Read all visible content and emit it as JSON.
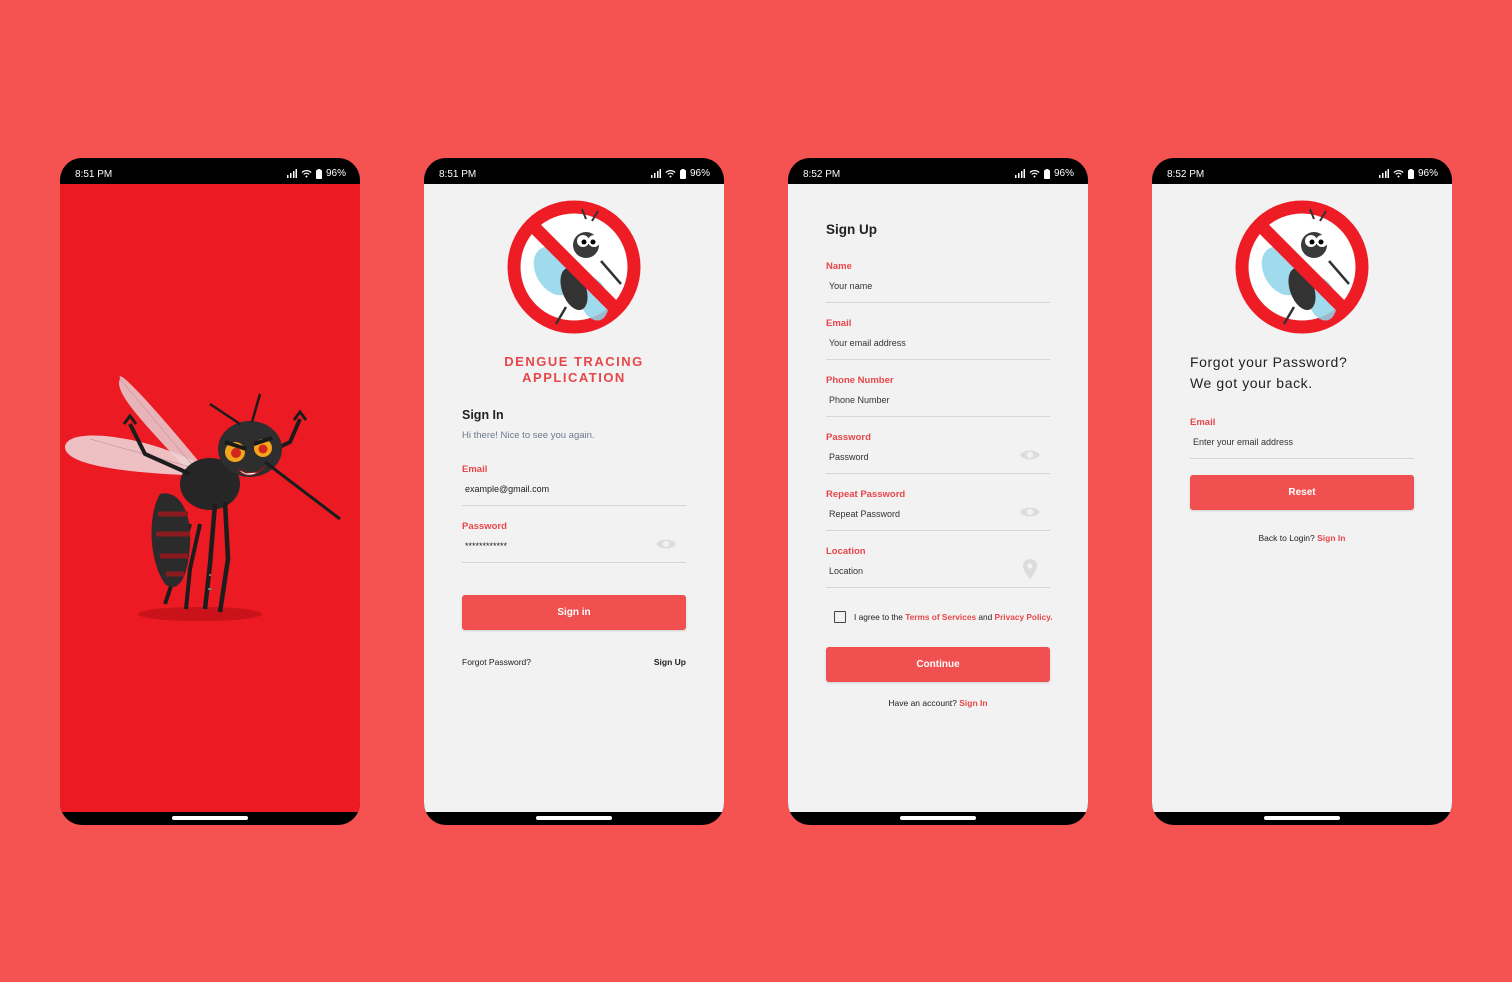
{
  "colors": {
    "background": "#f55252",
    "accent": "#f05050",
    "splash_red": "#ec1a22",
    "screen_bg": "#f2f2f2"
  },
  "phones": [
    {
      "time": "8:51 PM",
      "battery": "96%"
    },
    {
      "time": "8:51 PM",
      "battery": "96%"
    },
    {
      "time": "8:52 PM",
      "battery": "96%"
    },
    {
      "time": "8:52 PM",
      "battery": "96%"
    }
  ],
  "signin": {
    "app_title_line1": "DENGUE TRACING",
    "app_title_line2": "APPLICATION",
    "heading": "Sign In",
    "subtitle": "Hi there! Nice to see you again.",
    "email_label": "Email",
    "email_value": "example@gmail.com",
    "password_label": "Password",
    "password_value": "************",
    "button": "Sign in",
    "forgot": "Forgot Password?",
    "signup_link": "Sign Up"
  },
  "signup": {
    "heading": "Sign Up",
    "fields": [
      {
        "label": "Name",
        "placeholder": "Your name"
      },
      {
        "label": "Email",
        "placeholder": "Your email address"
      },
      {
        "label": "Phone Number",
        "placeholder": "Phone Number"
      },
      {
        "label": "Password",
        "placeholder": "Password"
      },
      {
        "label": "Repeat Password",
        "placeholder": "Repeat Password"
      },
      {
        "label": "Location",
        "placeholder": "Location"
      }
    ],
    "agree_prefix": "I agree to the ",
    "terms": "Terms of Services",
    "agree_and": " and ",
    "privacy": "Privacy Policy.",
    "button": "Continue",
    "have_account": "Have an account? ",
    "signin_link": "Sign In"
  },
  "forgot": {
    "heading_line1": "Forgot your Password?",
    "heading_line2": "We got your back.",
    "email_label": "Email",
    "email_placeholder": "Enter your email address",
    "button": "Reset",
    "back_text": "Back to Login? ",
    "signin_link": "Sign In"
  }
}
